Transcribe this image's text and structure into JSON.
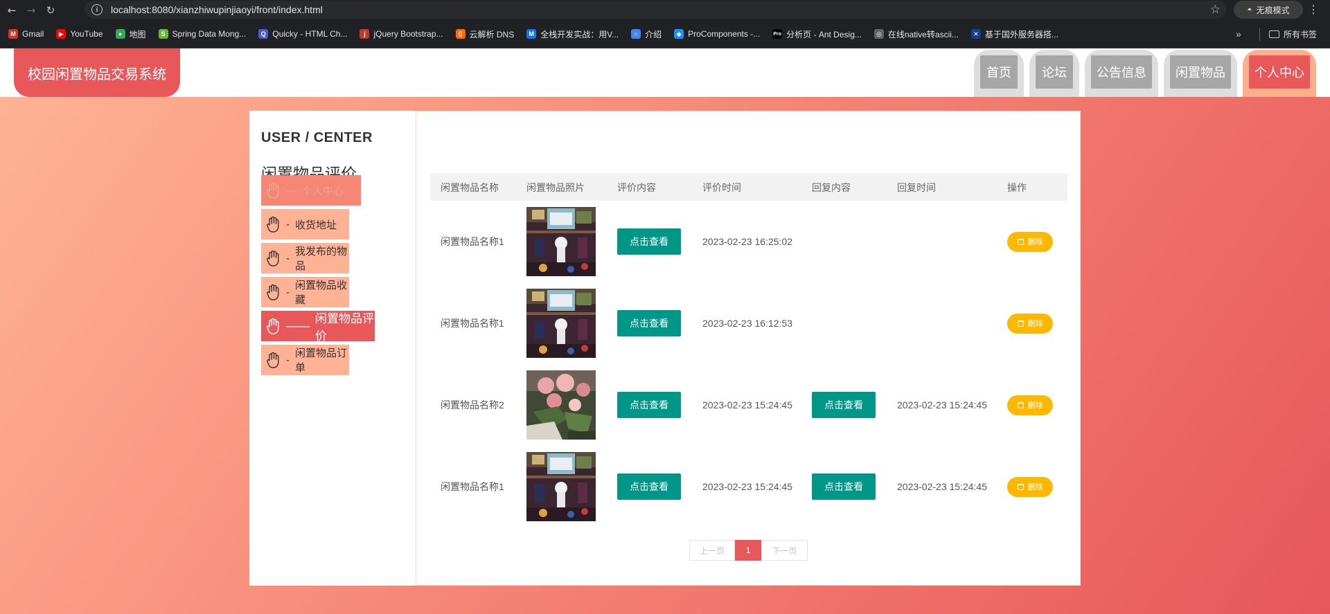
{
  "browser": {
    "url": "localhost:8080/xianzhiwupinjiaoyi/front/index.html",
    "incognito_label": "无痕模式",
    "bookmarks": [
      {
        "label": "Gmail",
        "color": "#d93025",
        "glyph": "M"
      },
      {
        "label": "YouTube",
        "color": "#ff0000",
        "glyph": "▶"
      },
      {
        "label": "地图",
        "color": "#34a853",
        "glyph": "●"
      },
      {
        "label": "Spring Data Mong...",
        "color": "#6db33f",
        "glyph": "S"
      },
      {
        "label": "Quicky - HTML Ch...",
        "color": "#4a5bd4",
        "glyph": "Q"
      },
      {
        "label": "jQuery Bootstrap...",
        "color": "#c0392b",
        "glyph": "j"
      },
      {
        "label": "云解析 DNS",
        "color": "#ff6a00",
        "glyph": "[]"
      },
      {
        "label": "全栈开发实战：用V...",
        "color": "#1a73e8",
        "glyph": "M"
      },
      {
        "label": "介绍",
        "color": "#4285f4",
        "glyph": "○"
      },
      {
        "label": "ProComponents -...",
        "color": "#1890ff",
        "glyph": "◆"
      },
      {
        "label": "分析页 - Ant Desig...",
        "color": "#000000",
        "glyph": "Pro"
      },
      {
        "label": "在线native转ascii...",
        "color": "#5f6368",
        "glyph": "◎"
      },
      {
        "label": "基于国外服务器搭...",
        "color": "#1a3c8f",
        "glyph": "✕"
      }
    ],
    "all_bookmarks_label": "所有书签"
  },
  "header": {
    "site_title": "校园闲置物品交易系统",
    "nav": [
      {
        "label": "首页"
      },
      {
        "label": "论坛"
      },
      {
        "label": "公告信息"
      },
      {
        "label": "闲置物品"
      },
      {
        "label": "个人中心"
      }
    ]
  },
  "sidebar": {
    "title_en": "USER / CENTER",
    "title_cn": "闲置物品评价",
    "items": [
      {
        "label": "个人中心",
        "dash": "—"
      },
      {
        "label": "收货地址",
        "dash": "-"
      },
      {
        "label": "我发布的物品",
        "dash": "-"
      },
      {
        "label": "闲置物品收藏",
        "dash": "-"
      },
      {
        "label": "闲置物品评价",
        "dash": "——"
      },
      {
        "label": "闲置物品订单",
        "dash": "-"
      }
    ]
  },
  "table": {
    "columns": [
      "闲置物品名称",
      "闲置物品照片",
      "评价内容",
      "评价时间",
      "回复内容",
      "回复时间",
      "操作"
    ],
    "view_label": "点击查看",
    "delete_label": "删除",
    "rows": [
      {
        "name": "闲置物品名称1",
        "photo": "store",
        "eval_time": "2023-02-23 16:25:02",
        "reply_content": "",
        "reply_time": ""
      },
      {
        "name": "闲置物品名称1",
        "photo": "store",
        "eval_time": "2023-02-23 16:12:53",
        "reply_content": "",
        "reply_time": ""
      },
      {
        "name": "闲置物品名称2",
        "photo": "flowers",
        "eval_time": "2023-02-23 15:24:45",
        "reply_content": "点击查看",
        "reply_time": "2023-02-23 15:24:45"
      },
      {
        "name": "闲置物品名称1",
        "photo": "store",
        "eval_time": "2023-02-23 15:24:45",
        "reply_content": "点击查看",
        "reply_time": "2023-02-23 15:24:45"
      }
    ]
  },
  "pagination": {
    "prev_label": "上一页",
    "current_page": "1",
    "next_label": "下一页"
  },
  "colors": {
    "brand_red": "#e8575a",
    "peach": "#ffb394",
    "teal": "#009688",
    "amber": "#ffb800"
  }
}
